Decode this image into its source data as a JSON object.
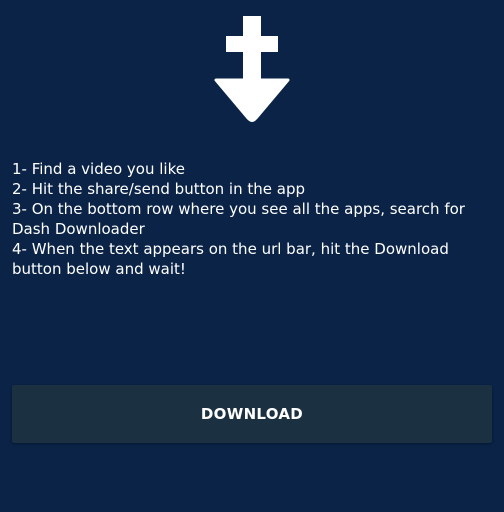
{
  "theme": {
    "background": "#0a2347",
    "button_background": "#1b3040",
    "text_color": "#ffffff"
  },
  "logo": {
    "icon": "download-arrow-icon"
  },
  "instructions": [
    "1- Find a video you like",
    "2- Hit the share/send button in the app",
    "3- On the bottom row where you see all the apps, search for Dash Downloader",
    "4- When the text appears on the url bar, hit the Download button below and wait!"
  ],
  "download_button": {
    "label": "DOWNLOAD"
  }
}
